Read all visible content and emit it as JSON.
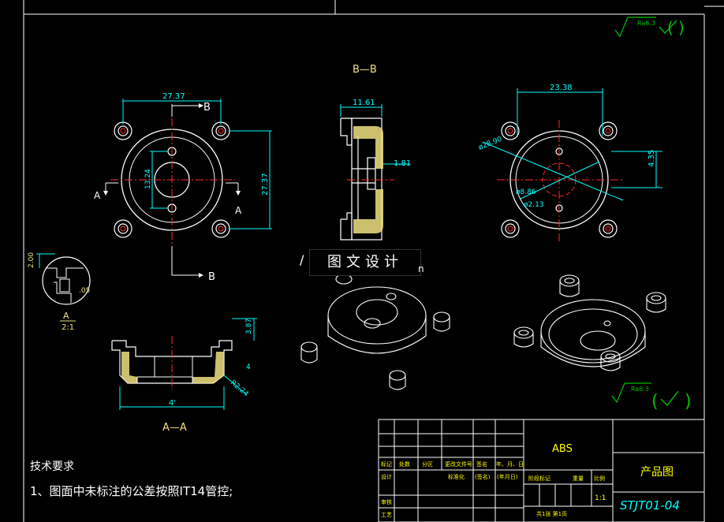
{
  "section_labels": {
    "bb_title": "B—B",
    "aa_title": "A—A",
    "cut_b": "B",
    "cut_a": "A",
    "detail_letter": "A",
    "detail_scale": "2:1"
  },
  "dimensions": {
    "front_width": "27.37",
    "front_height": "27.37",
    "front_hole_spacing": "13.24",
    "section_width": "11.61",
    "section_wall": "1.81",
    "top_width": "23.38",
    "top_dia_outer": "ø28.90",
    "top_dia_inner": "ø8.86",
    "top_dia_hole": "ø2.13",
    "top_offset": "4.35",
    "detail_height": "2.00",
    "detail_gap": ".05",
    "aa_height": "3.87",
    "aa_radius": "R2.24",
    "aa_width": "4'",
    "aa_side": "4"
  },
  "roughness": {
    "top_right": "Ra6.3",
    "bottom": "Ra6.3"
  },
  "watermark": {
    "text": "图文设计",
    "left_char": "/",
    "right_char": "n"
  },
  "tech_notes": {
    "heading": "技术要求",
    "line1": "1、图面中未标注的公差按照IT14管控;"
  },
  "title_block": {
    "material": "ABS",
    "drawing_type": "产品图",
    "drawing_number": "STJT01-04",
    "scale": "1:1",
    "headers": [
      "标记",
      "处数",
      "分区",
      "更改文件号",
      "签名",
      "年、月、日"
    ],
    "row_design": [
      "设计",
      "标准化",
      "(签名)",
      "(年月日)"
    ],
    "stage_headers": [
      "阶段标记",
      "重量",
      "比例"
    ],
    "row_review": "审核",
    "row_process": "工艺",
    "sheet_info": "共1张 第1页"
  },
  "colors": {
    "line": "#ffffff",
    "dim": "#00ffff",
    "center": "#ff2a2a",
    "hatch": "#f0e080",
    "title_text": "#ffff00",
    "green": "#00c000"
  }
}
